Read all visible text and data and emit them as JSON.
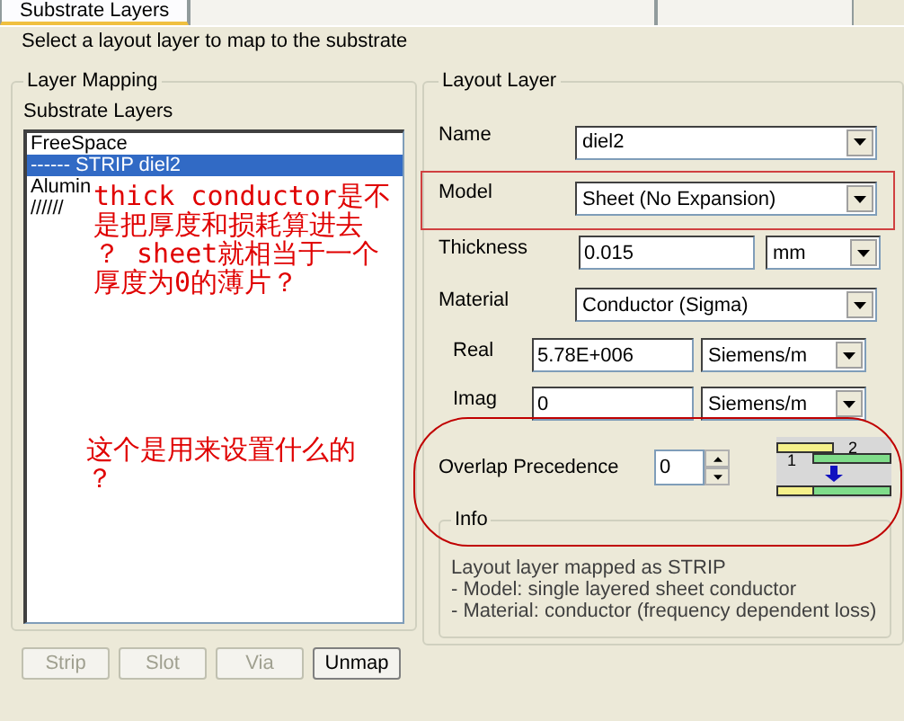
{
  "tabs": [
    {
      "label": "Substrate Layers",
      "selected": true
    },
    {
      "selected": false
    },
    {
      "selected": false
    }
  ],
  "instruction": "Select a layout layer to map to the substrate",
  "layer_mapping": {
    "title": "Layer Mapping",
    "list_label": "Substrate Layers",
    "items": [
      {
        "label": "FreeSpace",
        "selected": false
      },
      {
        "label": "------ STRIP diel2",
        "selected": true
      },
      {
        "label": "Alumin",
        "selected": false
      },
      {
        "label": "//////",
        "selected": false
      }
    ],
    "buttons": [
      {
        "label": "Strip",
        "disabled": true
      },
      {
        "label": "Slot",
        "disabled": true
      },
      {
        "label": "Via",
        "disabled": true
      },
      {
        "label": "Unmap",
        "disabled": false
      }
    ]
  },
  "layout_layer": {
    "title": "Layout Layer",
    "fields": [
      {
        "kind": "combo",
        "label": "Name",
        "value": "diel2"
      },
      {
        "kind": "combo",
        "label": "Model",
        "value": "Sheet (No Expansion)"
      },
      {
        "kind": "input_unit",
        "label": "Thickness",
        "value": "0.015",
        "unit": "mm"
      },
      {
        "kind": "combo",
        "label": "Material",
        "value": "Conductor (Sigma)"
      },
      {
        "kind": "sub_input_unit",
        "label": "Real",
        "value": "5.78E+006",
        "unit": "Siemens/m"
      },
      {
        "kind": "sub_input_unit",
        "label": "Imag",
        "value": "0",
        "unit": "Siemens/m"
      }
    ],
    "overlap": {
      "label": "Overlap Precedence",
      "value": "0",
      "diagram_labels": [
        "1",
        "2"
      ]
    },
    "info": {
      "title": "Info",
      "lines": [
        "Layout layer mapped as STRIP",
        " - Model: single layered sheet conductor",
        " - Material: conductor (frequency dependent loss)"
      ]
    }
  },
  "annotations": [
    {
      "lines": [
        "thick conductor是不",
        "是把厚度和损耗算进去",
        "？ sheet就相当于一个",
        "厚度为0的薄片？"
      ]
    },
    {
      "lines": [
        "这个是用来设置什么的",
        "？"
      ]
    }
  ]
}
